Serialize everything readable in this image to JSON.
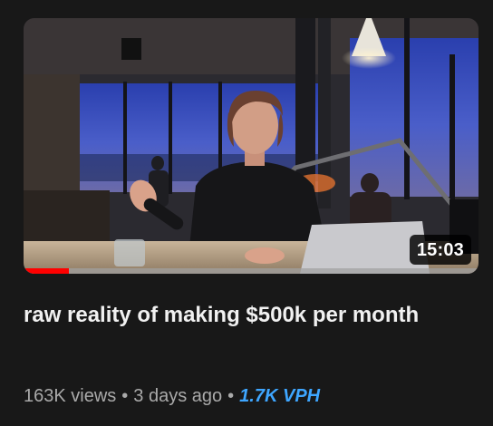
{
  "video": {
    "duration": "15:03",
    "watched_fraction": 0.1,
    "title": "raw reality of making $500k per month",
    "views": "163K views",
    "separator": "•",
    "age": "3 days ago",
    "vph": "1.7K VPH"
  },
  "colors": {
    "background": "#181818",
    "title": "#f1f1f1",
    "meta": "#aaaaaa",
    "vph_accent": "#3ea6ff",
    "progress": "#ff0000"
  }
}
